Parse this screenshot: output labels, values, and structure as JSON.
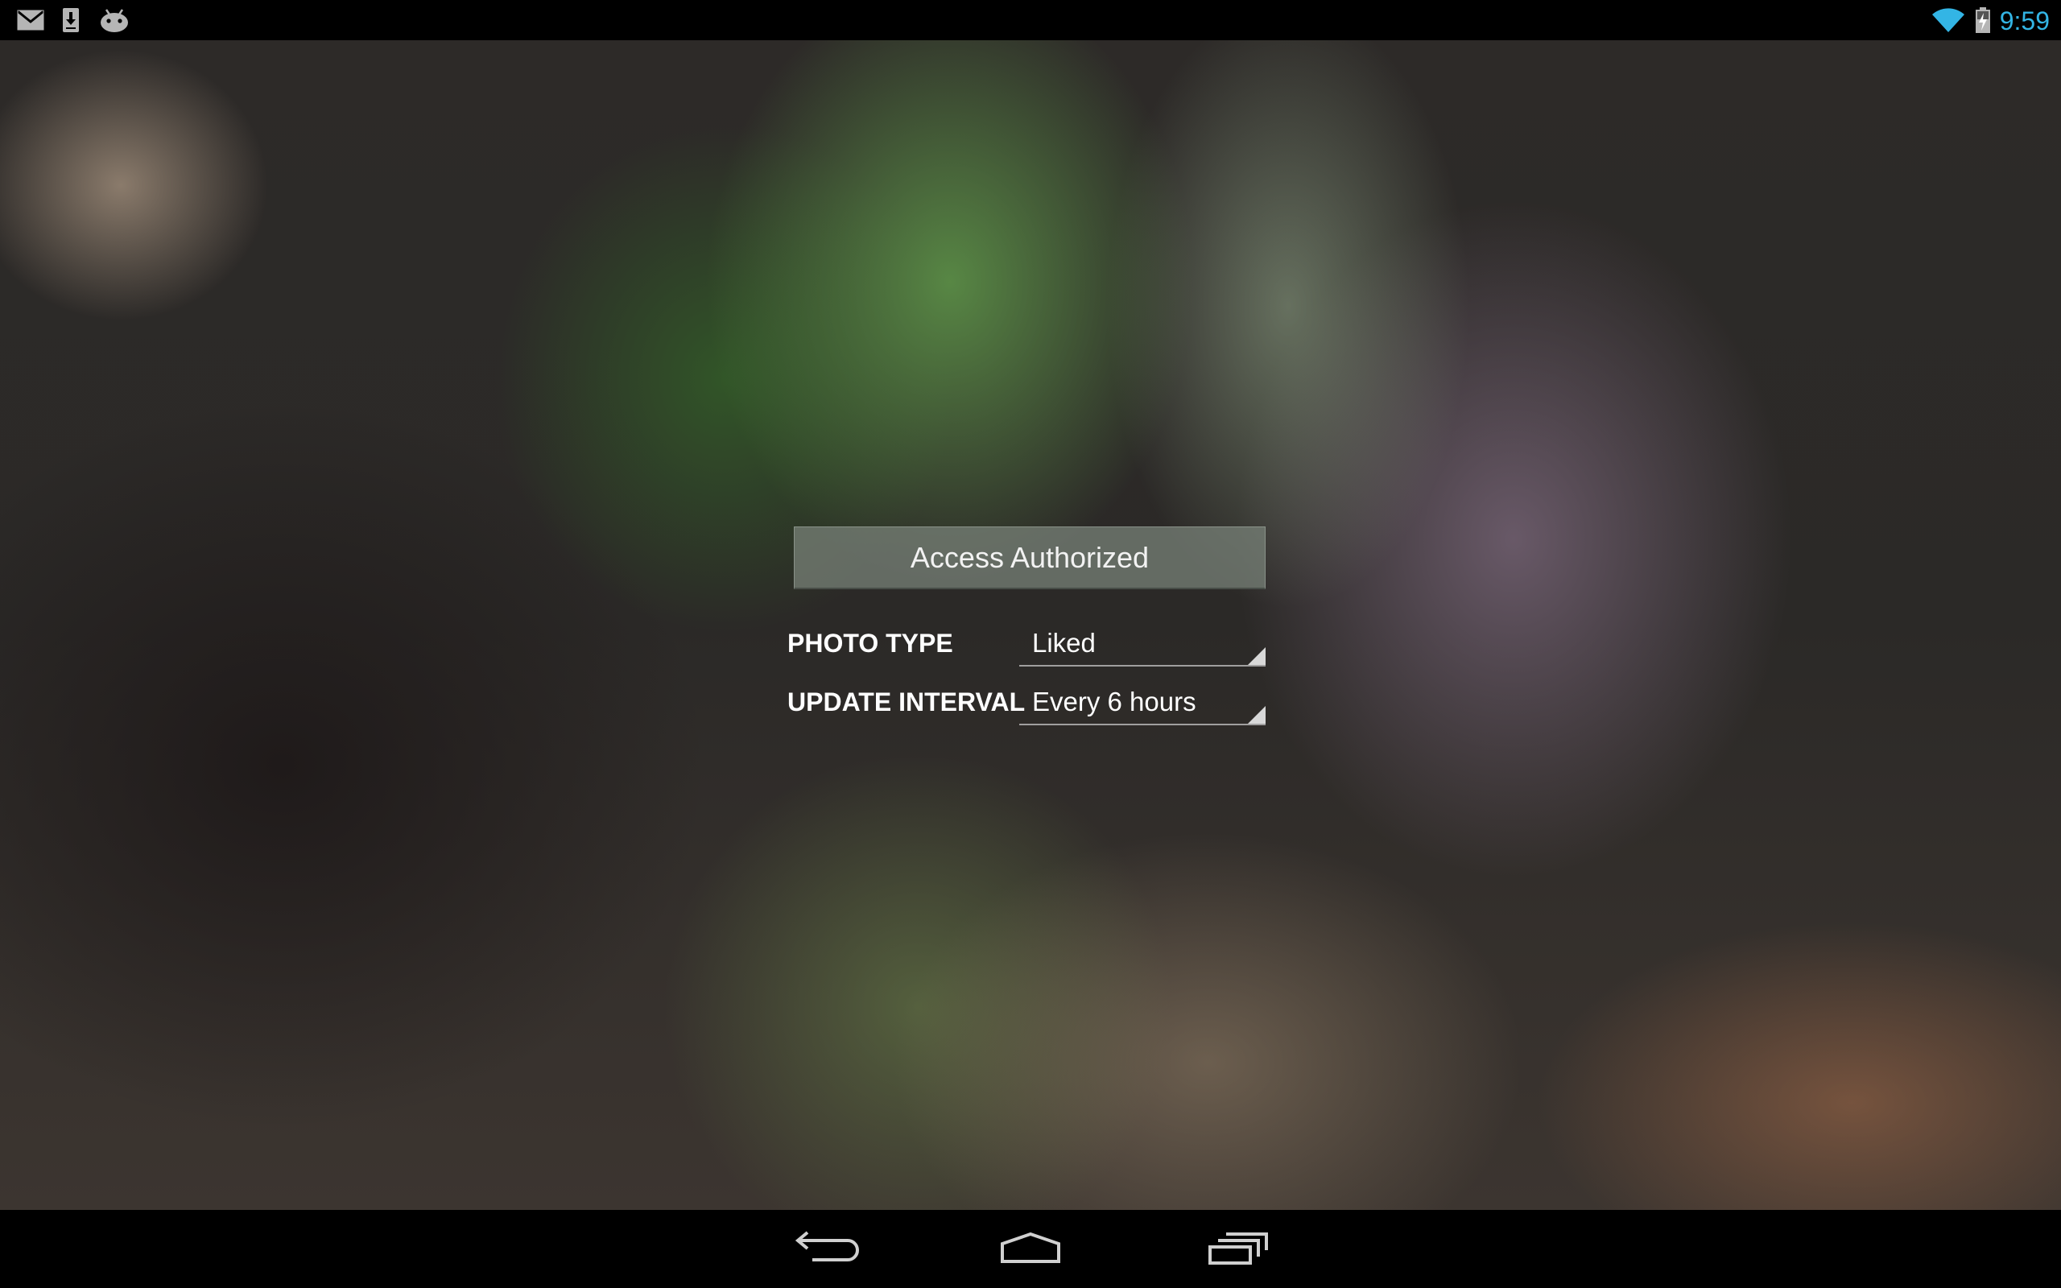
{
  "status_bar": {
    "notification_icons": [
      "gmail-icon",
      "download-icon",
      "android-icon"
    ],
    "system_icons": [
      "wifi-icon",
      "battery-charging-icon"
    ],
    "time": "9:59",
    "accent_color": "#33b5e5"
  },
  "settings": {
    "access_button_label": "Access Authorized",
    "photo_type": {
      "label": "PHOTO TYPE",
      "value": "Liked"
    },
    "update_interval": {
      "label": "UPDATE INTERVAL",
      "value": "Every 6 hours"
    }
  },
  "nav_bar": {
    "buttons": [
      "back-icon",
      "home-icon",
      "recents-icon"
    ]
  }
}
